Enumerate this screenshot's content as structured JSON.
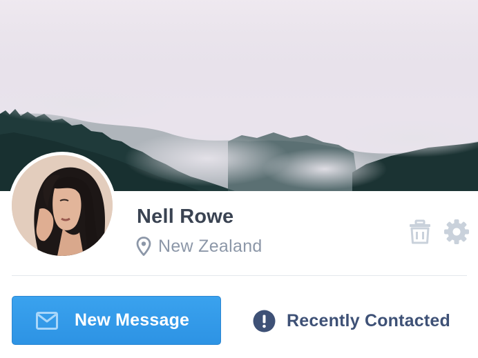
{
  "profile": {
    "name": "Nell Rowe",
    "location": "New Zealand"
  },
  "actions": {
    "new_message_label": "New Message",
    "recently_contacted_label": "Recently Contacted"
  },
  "icons": {
    "location": "map-pin-icon",
    "delete": "trash-icon",
    "settings": "gear-icon",
    "message": "mail-icon",
    "alert": "alert-icon"
  },
  "colors": {
    "primary_button": "#2f96e6",
    "name_text": "#3a4352",
    "secondary_text": "#8c97a8",
    "link_text": "#3e5176",
    "icon_muted": "#c9d1db"
  }
}
